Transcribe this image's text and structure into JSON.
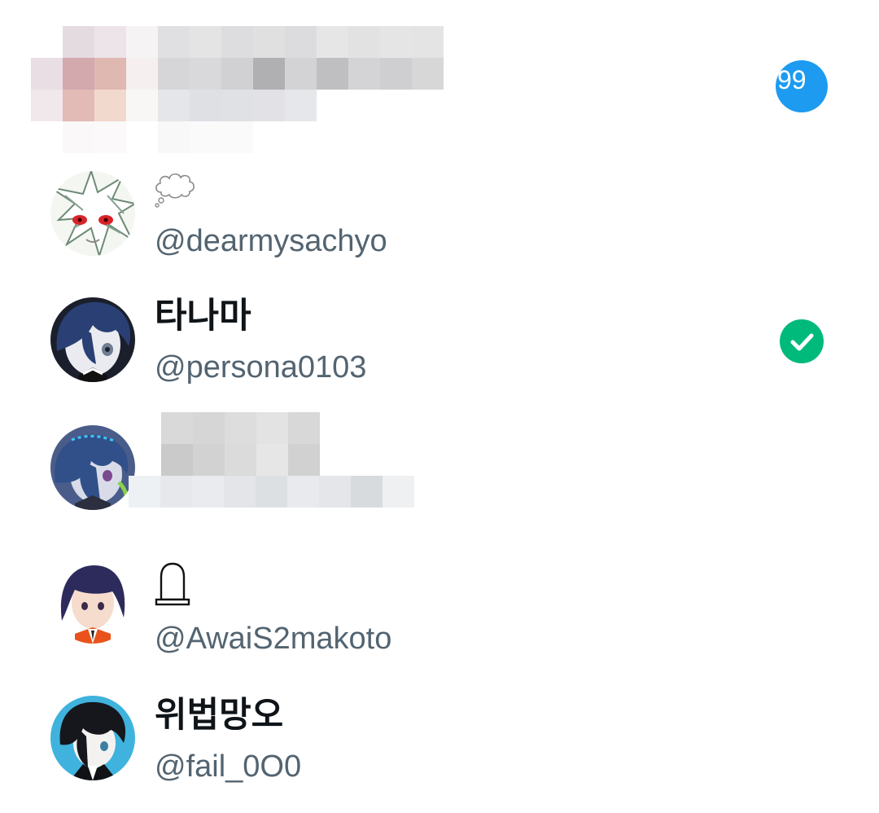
{
  "unread_badge": {
    "count": "99"
  },
  "accounts": [
    {
      "display_name": "",
      "handle": "@dearmysachyo",
      "name_icon": "thought-balloon-emoji"
    },
    {
      "display_name": "타나마",
      "handle": "@persona0103",
      "status": "selected",
      "status_icon": "check-circle-icon"
    },
    {
      "display_name": "",
      "handle": "",
      "note": ""
    },
    {
      "display_name": "",
      "handle": "@AwaiS2makoto",
      "name_icon": "headstone-emoji"
    },
    {
      "display_name": "위법망오",
      "handle": "@fail_0O0"
    }
  ],
  "colors": {
    "badge_blue": "#1d9bf0",
    "check_green": "#00ba7c",
    "name_text": "#0f1419",
    "handle_text": "#536471"
  }
}
